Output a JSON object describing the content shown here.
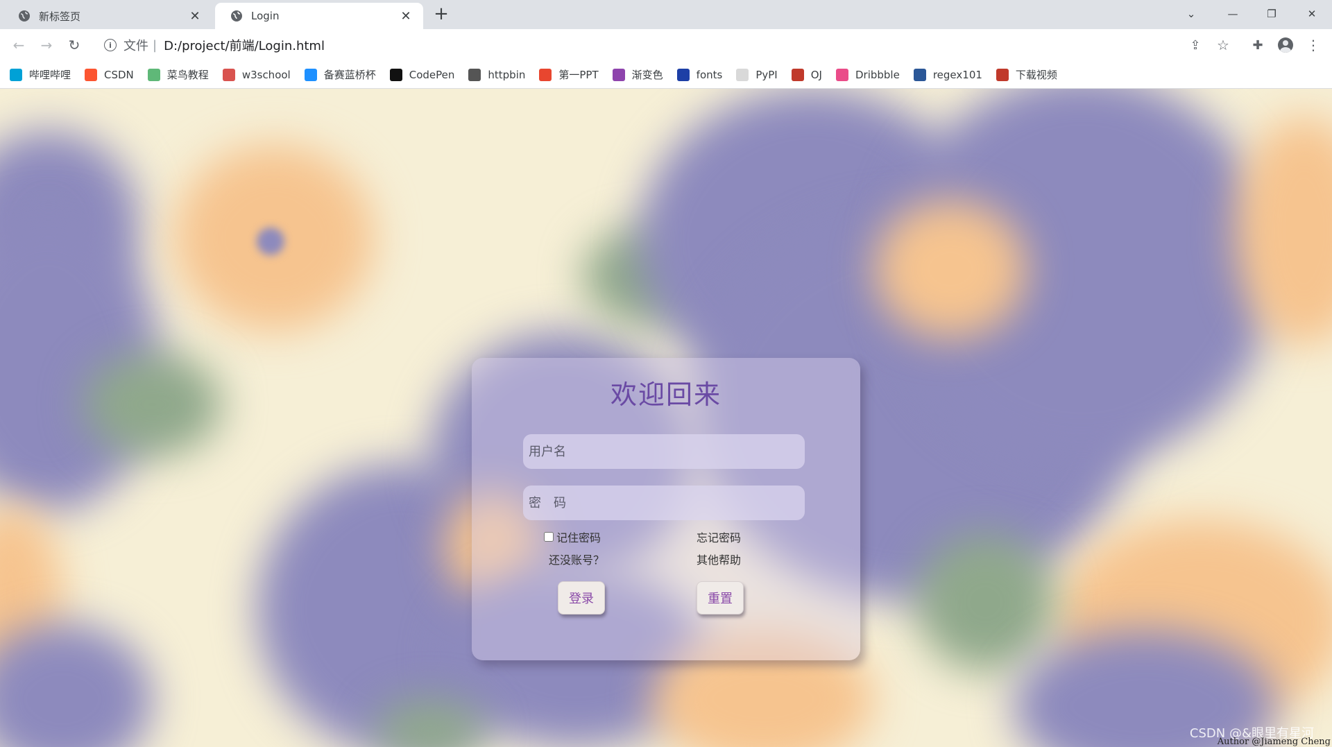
{
  "tabs": [
    {
      "title": "新标签页",
      "active": false
    },
    {
      "title": "Login",
      "active": true
    }
  ],
  "address": {
    "label": "文件",
    "separator": "|",
    "url": "D:/project/前端/Login.html"
  },
  "bookmarks": [
    {
      "label": "哔哩哔哩",
      "icon": "bilibili-icon",
      "color": "#00a1d6"
    },
    {
      "label": "CSDN",
      "icon": "csdn-icon",
      "color": "#fc5531"
    },
    {
      "label": "菜鸟教程",
      "icon": "runoob-icon",
      "color": "#5fb878"
    },
    {
      "label": "w3school",
      "icon": "w3school-icon",
      "color": "#d9534f"
    },
    {
      "label": "备赛蓝桥杯",
      "icon": "lanqiao-icon",
      "color": "#1e90ff"
    },
    {
      "label": "CodePen",
      "icon": "codepen-icon",
      "color": "#111111"
    },
    {
      "label": "httpbin",
      "icon": "httpbin-icon",
      "color": "#555555"
    },
    {
      "label": "第一PPT",
      "icon": "ppt-icon",
      "color": "#e8462f"
    },
    {
      "label": "渐变色",
      "icon": "gradient-icon",
      "color": "#8e44ad"
    },
    {
      "label": "fonts",
      "icon": "fonts-icon",
      "color": "#1d3fa6"
    },
    {
      "label": "PyPI",
      "icon": "pypi-icon",
      "color": "#d9d9d9"
    },
    {
      "label": "OJ",
      "icon": "oj-icon",
      "color": "#c0392b"
    },
    {
      "label": "Dribbble",
      "icon": "dribbble-icon",
      "color": "#ea4c89"
    },
    {
      "label": "regex101",
      "icon": "regex101-icon",
      "color": "#2b5797"
    },
    {
      "label": "下载视频",
      "icon": "download-video-icon",
      "color": "#c0392b"
    }
  ],
  "login": {
    "title": "欢迎回来",
    "username_placeholder": "用户名",
    "password_placeholder": "密　码",
    "remember_label": "记住密码",
    "forget_label": "忘记密码",
    "no_account_label": "还没账号？",
    "other_help_label": "其他帮助",
    "login_button": "登录",
    "reset_button": "重置"
  },
  "watermark": "CSDN @&眼里有星河",
  "author": "Author @Jiameng Cheng",
  "colors": {
    "accent": "#6a4aa4",
    "button_text": "#8a4aa8",
    "purple_blob": "#8d8abd",
    "orange_blob": "#f6c48f",
    "green_blob": "#8fa88b",
    "page_bg": "#f6efd6"
  }
}
